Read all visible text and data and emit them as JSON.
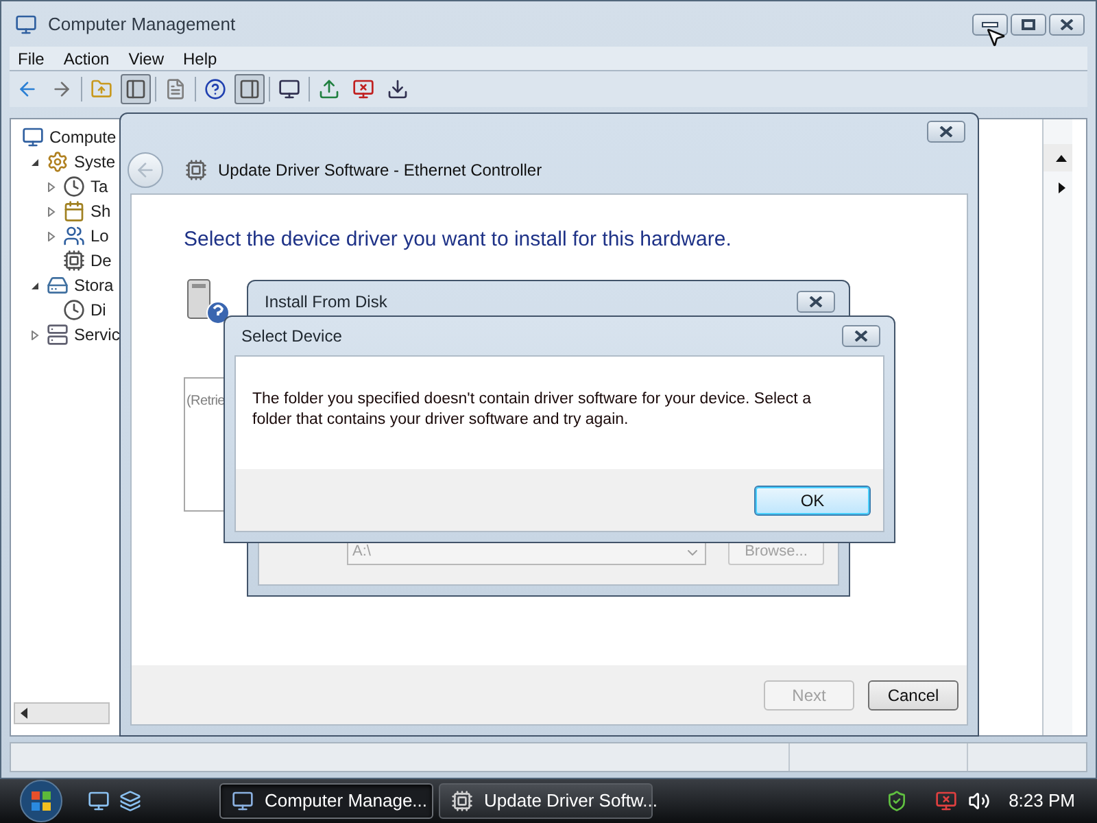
{
  "main_window": {
    "title": "Computer Management",
    "menu": [
      "File",
      "Action",
      "View",
      "Help"
    ],
    "toolbar": [
      {
        "pressed": false
      },
      {
        "pressed": false
      },
      {
        "pressed": false
      },
      {
        "pressed": true
      },
      {
        "pressed": false
      },
      {
        "pressed": false
      },
      {
        "pressed": true
      },
      {
        "pressed": false
      },
      {
        "pressed": false
      },
      {
        "pressed": false
      },
      {
        "pressed": false
      }
    ],
    "tree": [
      {
        "label": "Compute",
        "children": [
          {
            "label": "Syste",
            "expanded": true,
            "children": [
              {
                "label": "Ta",
                "expanded": false
              },
              {
                "label": "Sh",
                "expanded": false
              },
              {
                "label": "Lo",
                "expanded": false
              },
              {
                "label": "De"
              }
            ]
          },
          {
            "label": "Stora",
            "expanded": true,
            "children": [
              {
                "label": "Di"
              }
            ]
          },
          {
            "label": "Servic",
            "expanded": false
          }
        ]
      }
    ]
  },
  "wizard": {
    "title": "Update Driver Software - Ethernet Controller",
    "heading": "Select the device driver you want to install for this hardware.",
    "list_text": "(Retrie",
    "buttons": [
      {
        "label": "Next",
        "disabled": true
      },
      {
        "label": "Cancel",
        "disabled": false
      }
    ]
  },
  "install_from_disk": {
    "title": "Install From Disk",
    "path": "A:\\",
    "browse": {
      "label": "Browse...",
      "disabled": true
    }
  },
  "select_device": {
    "title": "Select Device",
    "message": "The folder you specified doesn't contain driver software for your device. Select a folder that contains your driver software and try again.",
    "button": "OK"
  },
  "taskbar": {
    "tasks": [
      {
        "label": "Computer Manage...",
        "selected": true
      },
      {
        "label": "Update Driver Softw...",
        "selected": false
      }
    ],
    "clock": "8:23 PM"
  }
}
